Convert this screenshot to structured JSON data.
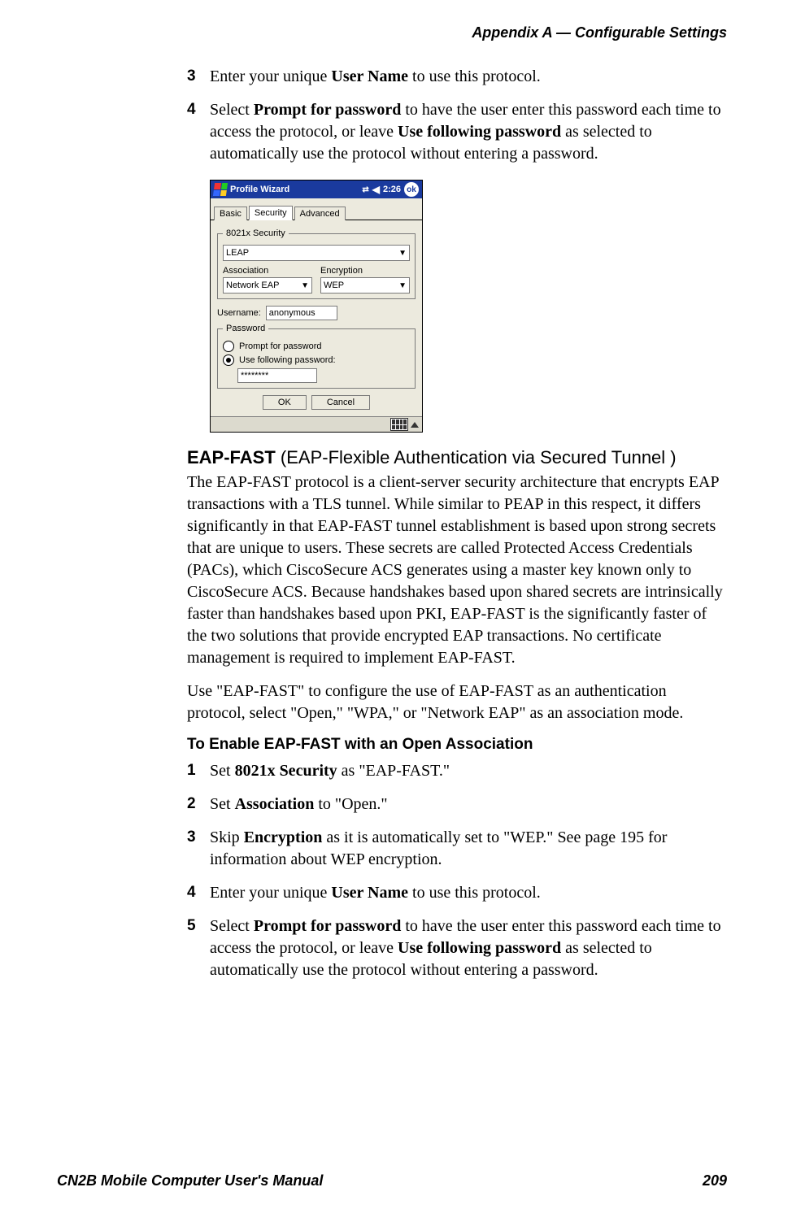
{
  "header": {
    "right": "Appendix A —  Configurable Settings"
  },
  "footer": {
    "left": "CN2B Mobile Computer User's Manual",
    "right": "209"
  },
  "top_steps": [
    {
      "num": "3",
      "text_before": "Enter your unique ",
      "bold1": "User Name",
      "text_after": " to use this protocol."
    },
    {
      "num": "4",
      "text_before": "Select ",
      "bold1": "Prompt for password",
      "text_mid": " to have the user enter this password each time to access the protocol, or leave ",
      "bold2": "Use following password",
      "text_after": " as selected to automatically use the protocol without entering a password."
    }
  ],
  "device": {
    "title": "Profile Wizard",
    "time": "2:26",
    "ok": "ok",
    "tabs": {
      "basic": "Basic",
      "security": "Security",
      "advanced": "Advanced"
    },
    "sec_legend": "8021x Security",
    "sec_value": "LEAP",
    "assoc_label": "Association",
    "assoc_value": "Network EAP",
    "enc_label": "Encryption",
    "enc_value": "WEP",
    "username_label": "Username:",
    "username_value": "anonymous",
    "pwd_legend": "Password",
    "radio_prompt": "Prompt for password",
    "radio_use": "Use following password:",
    "pwd_value": "********",
    "ok_btn": "OK",
    "cancel_btn": "Cancel"
  },
  "section": {
    "heading_bold": "EAP-FAST",
    "heading_rest": " (EAP-Flexible Authentication via Secured Tunnel )",
    "para1": "The EAP-FAST protocol is a client-server security architecture that encrypts EAP transactions with a TLS tunnel. While similar to PEAP in this respect, it differs significantly in that EAP-FAST tunnel establishment is based upon strong secrets that are unique to users. These secrets are called Protected Access Credentials (PACs), which CiscoSecure ACS generates using a master key known only to CiscoSecure ACS. Because handshakes based upon shared secrets are intrinsically faster than handshakes based upon PKI, EAP-FAST is the significantly faster of the two solutions that provide encrypted EAP transactions. No certificate management is required to implement EAP-FAST.",
    "para2": "Use \"EAP-FAST\" to configure the use of EAP-FAST as an authentication protocol, select \"Open,\" \"WPA,\" or \"Network EAP\" as an association mode.",
    "sub_heading": "To Enable EAP-FAST with an Open Association"
  },
  "bottom_steps": [
    {
      "num": "1",
      "pre": "Set ",
      "b1": "8021x Security",
      "post": " as \"EAP-FAST.\""
    },
    {
      "num": "2",
      "pre": "Set ",
      "b1": "Association",
      "post": " to \"Open.\""
    },
    {
      "num": "3",
      "pre": "Skip ",
      "b1": "Encryption",
      "post": " as it is automatically set to \"WEP.\" See page 195 for information about WEP encryption."
    },
    {
      "num": "4",
      "pre": "Enter your unique ",
      "b1": "User Name",
      "post": " to use this protocol."
    },
    {
      "num": "5",
      "pre": "Select ",
      "b1": "Prompt for password",
      "mid": " to have the user enter this password each time to access the protocol, or leave ",
      "b2": "Use following password",
      "post": " as selected to automatically use the protocol without entering a password."
    }
  ]
}
